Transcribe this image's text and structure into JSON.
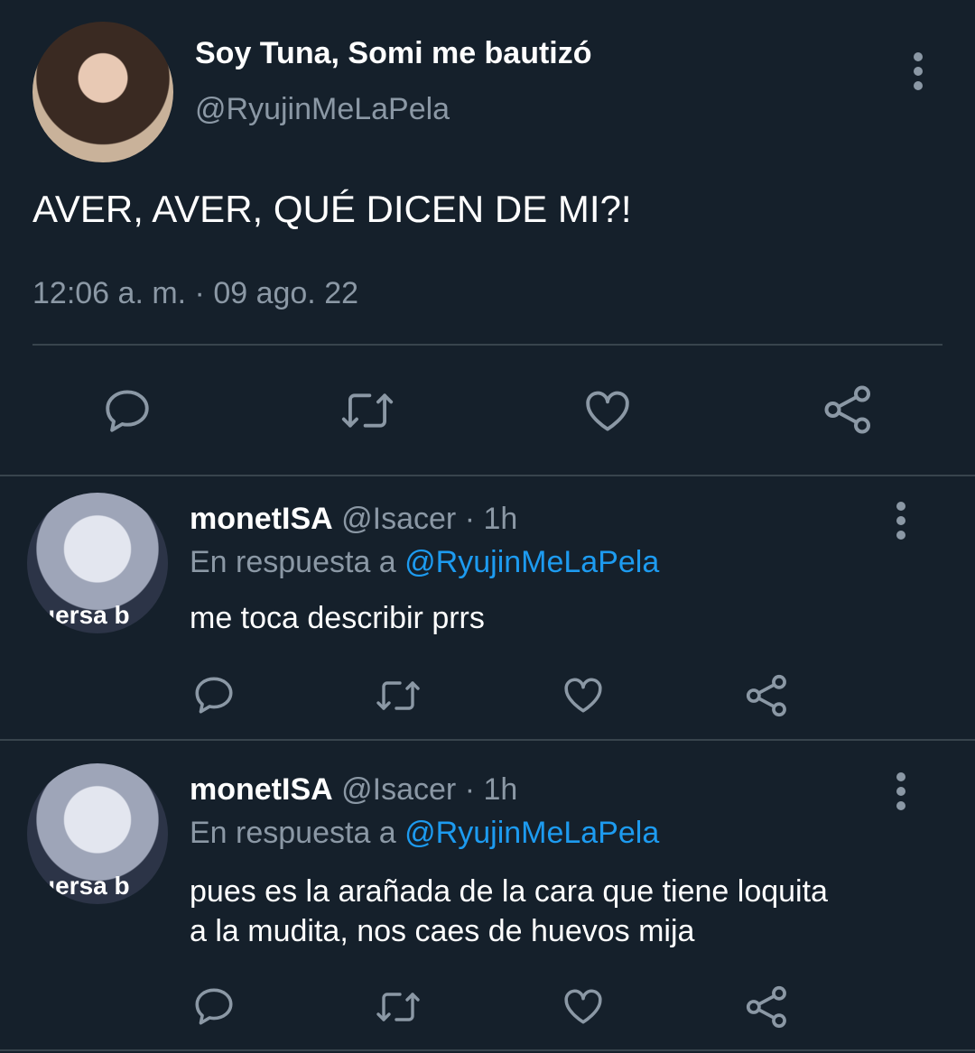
{
  "main_tweet": {
    "display_name": "Soy Tuna, Somi me bautizó",
    "handle": "@RyujinMeLaPela",
    "text": "AVER, AVER, QUÉ DICEN DE MI?!",
    "timestamp": "12:06 a. m. · 09 ago. 22",
    "actions": [
      "reply-icon",
      "retweet-icon",
      "like-icon",
      "share-icon"
    ]
  },
  "replies": [
    {
      "display_name": "monetISA",
      "handle": "@Isacer",
      "time": "· 1h",
      "reply_prefix": "En respuesta a",
      "reply_to": "@RyujinMeLaPela",
      "text_lines": [
        "me toca describir prrs"
      ],
      "avatar_caption": "uersa b"
    },
    {
      "display_name": "monetISA",
      "handle": "@Isacer",
      "time": "· 1h",
      "reply_prefix": "En respuesta a",
      "reply_to": "@RyujinMeLaPela",
      "text_lines": [
        "pues es la arañada de la cara que tiene loquita",
        "a la mudita, nos caes de huevos mija"
      ],
      "avatar_caption": "uersa b"
    }
  ],
  "colors": {
    "background": "#15202b",
    "divider": "#38444d",
    "muted": "#8b98a5",
    "link": "#1d9bf0"
  }
}
